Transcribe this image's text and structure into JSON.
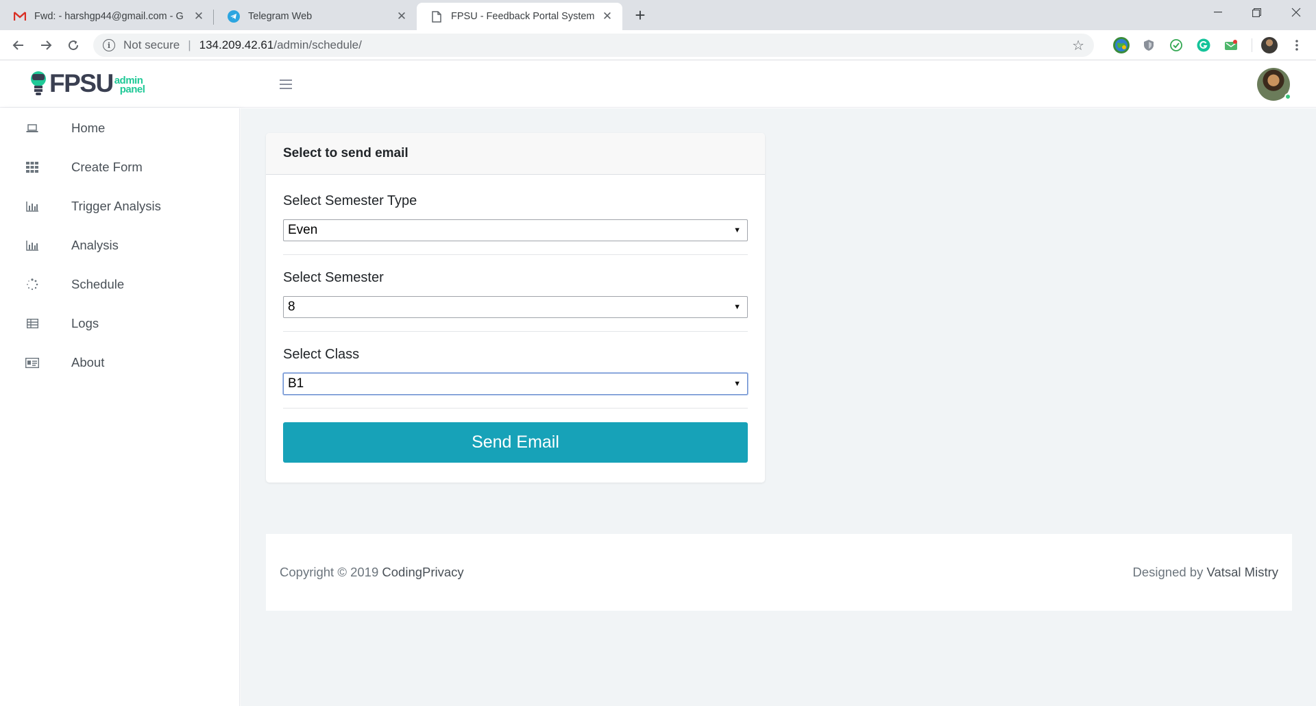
{
  "browser": {
    "tabs": [
      {
        "title": "Fwd: - harshgp44@gmail.com - G",
        "icon": "gmail-icon",
        "active": false
      },
      {
        "title": "Telegram Web",
        "icon": "telegram-icon",
        "active": false
      },
      {
        "title": "FPSU - Feedback Portal System fo",
        "icon": "page-icon",
        "active": true
      }
    ],
    "close_glyph": "✕",
    "new_tab_glyph": "+",
    "address": {
      "security_label": "Not secure",
      "host": "134.209.42.61",
      "path": "/admin/schedule/"
    }
  },
  "app": {
    "logo": {
      "word": "FPSU",
      "sub_line1": "admin",
      "sub_line2": "panel",
      "accent_color": "#20c997"
    },
    "sidebar": {
      "items": [
        {
          "label": "Home",
          "icon": "laptop-icon"
        },
        {
          "label": "Create Form",
          "icon": "grid-icon"
        },
        {
          "label": "Trigger Analysis",
          "icon": "bar-chart-icon"
        },
        {
          "label": "Analysis",
          "icon": "bar-chart-icon"
        },
        {
          "label": "Schedule",
          "icon": "spinner-icon"
        },
        {
          "label": "Logs",
          "icon": "table-icon"
        },
        {
          "label": "About",
          "icon": "id-card-icon"
        }
      ]
    },
    "form": {
      "title": "Select to send email",
      "fields": [
        {
          "label": "Select Semester Type",
          "value": "Even"
        },
        {
          "label": "Select Semester",
          "value": "8"
        },
        {
          "label": "Select Class",
          "value": "B1"
        }
      ],
      "submit_label": "Send Email",
      "button_color": "#17a2b8"
    },
    "footer": {
      "copyright_prefix": "Copyright © 2019",
      "copyright_owner": "CodingPrivacy",
      "designed_prefix": "Designed by",
      "designer": "Vatsal Mistry"
    }
  }
}
